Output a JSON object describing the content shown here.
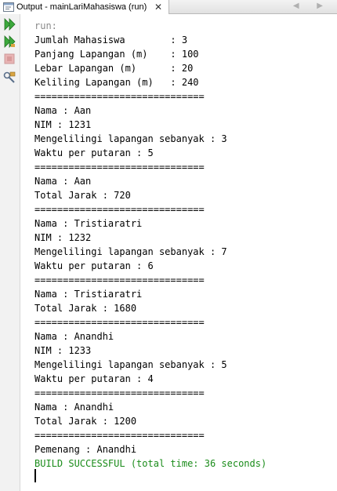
{
  "tab": {
    "title": "Output - mainLariMahasiswa (run)",
    "close": "✕",
    "nav": "◀ ▶"
  },
  "console": {
    "lines": [
      {
        "text": "run:",
        "style": "gray"
      },
      {
        "text": "Jumlah Mahasiswa        : 3",
        "style": ""
      },
      {
        "text": "Panjang Lapangan (m)    : 100",
        "style": ""
      },
      {
        "text": "Lebar Lapangan (m)      : 20",
        "style": ""
      },
      {
        "text": "Keliling Lapangan (m)   : 240",
        "style": ""
      },
      {
        "text": "==============================",
        "style": ""
      },
      {
        "text": "Nama : Aan",
        "style": ""
      },
      {
        "text": "NIM : 1231",
        "style": ""
      },
      {
        "text": "Mengelilingi lapangan sebanyak : 3",
        "style": ""
      },
      {
        "text": "Waktu per putaran : 5",
        "style": ""
      },
      {
        "text": "==============================",
        "style": ""
      },
      {
        "text": "Nama : Aan",
        "style": ""
      },
      {
        "text": "Total Jarak : 720",
        "style": ""
      },
      {
        "text": "==============================",
        "style": ""
      },
      {
        "text": "Nama : Tristiaratri",
        "style": ""
      },
      {
        "text": "NIM : 1232",
        "style": ""
      },
      {
        "text": "Mengelilingi lapangan sebanyak : 7",
        "style": ""
      },
      {
        "text": "Waktu per putaran : 6",
        "style": ""
      },
      {
        "text": "==============================",
        "style": ""
      },
      {
        "text": "Nama : Tristiaratri",
        "style": ""
      },
      {
        "text": "Total Jarak : 1680",
        "style": ""
      },
      {
        "text": "==============================",
        "style": ""
      },
      {
        "text": "Nama : Anandhi",
        "style": ""
      },
      {
        "text": "NIM : 1233",
        "style": ""
      },
      {
        "text": "Mengelilingi lapangan sebanyak : 5",
        "style": ""
      },
      {
        "text": "Waktu per putaran : 4",
        "style": ""
      },
      {
        "text": "==============================",
        "style": ""
      },
      {
        "text": "Nama : Anandhi",
        "style": ""
      },
      {
        "text": "Total Jarak : 1200",
        "style": ""
      },
      {
        "text": "==============================",
        "style": ""
      },
      {
        "text": "Pemenang : Anandhi",
        "style": ""
      },
      {
        "text": "BUILD SUCCESSFUL (total time: 36 seconds)",
        "style": "green"
      }
    ]
  },
  "toolbar": {
    "buttons": [
      "rerun-icon",
      "rerun-with-options-icon",
      "stop-icon",
      "settings-icon"
    ]
  },
  "colors": {
    "run_text": "#8a8a8a",
    "build_success": "#1a8c1a",
    "rerun_green": "#3ca93c"
  }
}
